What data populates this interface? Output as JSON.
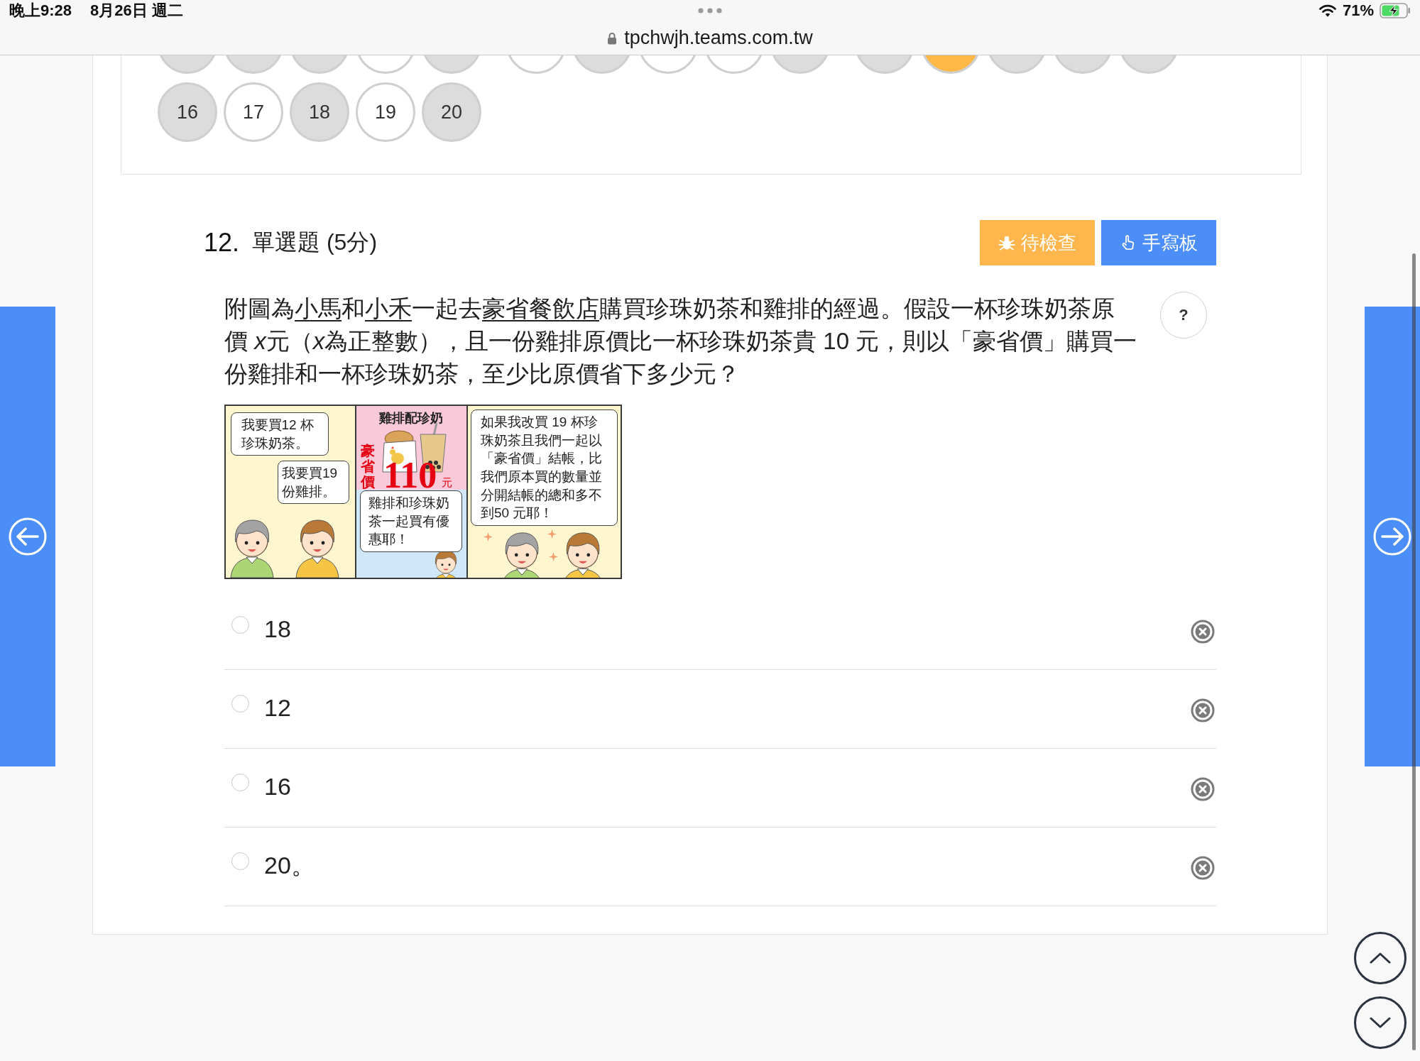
{
  "status_bar": {
    "time": "晚上9:28",
    "date": "8月26日 週二",
    "battery": "71%"
  },
  "address_bar": {
    "url": "tpchwjh.teams.com.tw"
  },
  "question_nav": {
    "covered_groups": [
      [
        {
          "answered": true,
          "selected": false
        },
        {
          "answered": true,
          "selected": false
        },
        {
          "answered": true,
          "selected": false
        },
        {
          "answered": false,
          "selected": false
        },
        {
          "answered": true,
          "selected": false
        }
      ],
      [
        {
          "answered": false,
          "selected": false
        },
        {
          "answered": true,
          "selected": false
        },
        {
          "answered": false,
          "selected": false
        },
        {
          "answered": false,
          "selected": false
        },
        {
          "answered": true,
          "selected": false
        }
      ],
      [
        {
          "answered": true,
          "selected": false
        },
        {
          "answered": false,
          "selected": true
        },
        {
          "answered": true,
          "selected": false
        },
        {
          "answered": true,
          "selected": false
        },
        {
          "answered": true,
          "selected": false
        }
      ]
    ],
    "groups": [
      [
        {
          "label": "16",
          "answered": true,
          "selected": false
        },
        {
          "label": "17",
          "answered": false,
          "selected": false
        },
        {
          "label": "18",
          "answered": true,
          "selected": false
        },
        {
          "label": "19",
          "answered": false,
          "selected": false
        },
        {
          "label": "20",
          "answered": true,
          "selected": false
        }
      ]
    ]
  },
  "question": {
    "number": "12.",
    "type": "單選題 (5分)",
    "actions": [
      {
        "kind": "review",
        "label": "待檢查"
      },
      {
        "kind": "handwriting",
        "label": "手寫板"
      }
    ],
    "help": "?",
    "stem": [
      {
        "text": "附圖為",
        "kind": "plain"
      },
      {
        "text": "小馬",
        "kind": "underline"
      },
      {
        "text": "和",
        "kind": "plain"
      },
      {
        "text": "小禾",
        "kind": "underline"
      },
      {
        "text": "一起去",
        "kind": "plain"
      },
      {
        "text": "豪省餐飲店",
        "kind": "underline"
      },
      {
        "text": "購買珍珠奶茶和雞排的經過。假設一杯珍珠奶茶原價 ",
        "kind": "plain"
      },
      {
        "text": "x",
        "kind": "italic"
      },
      {
        "text": "元（",
        "kind": "plain"
      },
      {
        "text": "x",
        "kind": "italic"
      },
      {
        "text": "為正整數），且一份雞排原價比一杯珍珠奶茶貴 10 元，則以「豪省價」購買一份雞排和一杯珍珠奶茶，至少比原價省下多少元？",
        "kind": "plain"
      }
    ],
    "comic": {
      "panels": [
        {
          "kind": "talk",
          "bubbles": [
            "我要買12 杯珍珠奶茶。",
            "我要買19份雞排。"
          ]
        },
        {
          "kind": "poster",
          "title": "雞排配珍奶",
          "price_label": "豪省價",
          "price": "110",
          "unit": "元",
          "bubbles": [
            "雞排和珍珠奶茶一起買有優惠耶！"
          ]
        },
        {
          "kind": "cheer",
          "bubbles": [
            "如果我改買 19 杯珍珠奶茶且我們一起以「豪省價」結帳，比我們原本買的數量並分開結帳的總和多不到50 元耶！"
          ]
        }
      ]
    },
    "options": [
      {
        "text": "18",
        "selected": false
      },
      {
        "text": "12",
        "selected": false
      },
      {
        "text": "16",
        "selected": false
      },
      {
        "text": "20。",
        "selected": false
      }
    ]
  }
}
